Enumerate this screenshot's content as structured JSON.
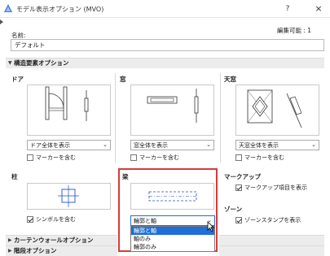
{
  "window": {
    "title": "モデル表示オプション (MVO)",
    "help_label": "?",
    "close_label": "×"
  },
  "editable_info": "編集可能 : 1",
  "name_label": "名前:",
  "name_value": "デフォルト",
  "sections": {
    "construction_elements": "構造要素オプション",
    "curtain_wall": "カーテンウォールオプション",
    "stair": "階段オプション"
  },
  "door": {
    "title": "ドア",
    "select_value": "ドア全体を表示",
    "marker_label": "マーカーを含む",
    "marker_checked": false
  },
  "window_opt": {
    "title": "窓",
    "select_value": "窓全体を表示",
    "marker_label": "マーカーを含む",
    "marker_checked": false
  },
  "skylight": {
    "title": "天窓",
    "select_value": "天窓全体を表示",
    "marker_label": "マーカーを含む",
    "marker_checked": false
  },
  "column": {
    "title": "柱",
    "symbol_label": "シンボルを含む",
    "symbol_checked": true
  },
  "beam": {
    "title": "梁",
    "select_value": "輪郭と軸",
    "options": [
      "輪郭と軸",
      "軸のみ",
      "輪郭のみ"
    ],
    "selected_index": 0
  },
  "markup": {
    "title": "マークアップ",
    "show_label": "マークアップ項目を表示",
    "show_checked": true
  },
  "zone": {
    "title": "ゾーン",
    "stamp_label": "ゾーンスタンプを表示",
    "stamp_checked": true
  },
  "colors": {
    "accent": "#1e6fd9",
    "highlight_frame": "#d83a3a"
  }
}
